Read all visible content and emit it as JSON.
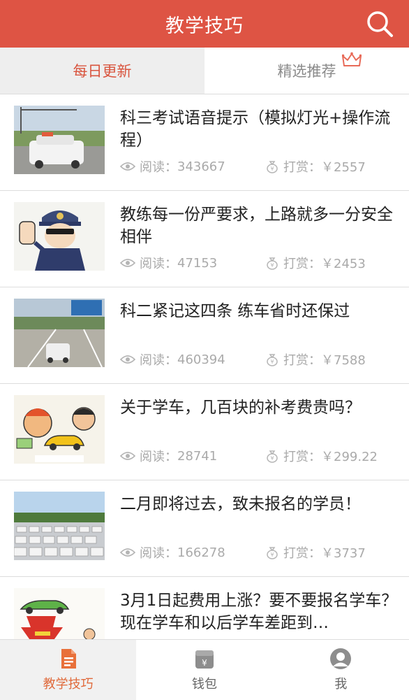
{
  "header": {
    "title": "教学技巧",
    "search_icon": "search-icon"
  },
  "tabs": [
    {
      "label": "每日更新",
      "active": true
    },
    {
      "label": "精选推荐",
      "active": false,
      "badge_icon": "crown-icon"
    }
  ],
  "articles": [
    {
      "title": "科三考试语音提示（模拟灯光+操作流程）",
      "read_label": "阅读：",
      "reads": "343667",
      "reward_label": "打赏：",
      "reward": "￥2557"
    },
    {
      "title": "教练每一份严要求，上路就多一分安全相伴",
      "read_label": "阅读：",
      "reads": "47153",
      "reward_label": "打赏：",
      "reward": "￥2453"
    },
    {
      "title": "科二紧记这四条 练车省时还保过",
      "read_label": "阅读：",
      "reads": "460394",
      "reward_label": "打赏：",
      "reward": "￥7588"
    },
    {
      "title": "关于学车，几百块的补考费贵吗？",
      "read_label": "阅读：",
      "reads": "28741",
      "reward_label": "打赏：",
      "reward": "￥299.22"
    },
    {
      "title": "二月即将过去，致未报名的学员！",
      "read_label": "阅读：",
      "reads": "166278",
      "reward_label": "打赏：",
      "reward": "￥3737"
    },
    {
      "title": "3月1日起费用上涨？要不要报名学车？现在学车和以后学车差距到…",
      "read_label": "",
      "reads": "",
      "reward_label": "",
      "reward": ""
    }
  ],
  "bottom_nav": [
    {
      "label": "教学技巧",
      "icon": "document-icon",
      "active": true
    },
    {
      "label": "钱包",
      "icon": "wallet-icon",
      "active": false
    },
    {
      "label": "我",
      "icon": "user-icon",
      "active": false
    }
  ],
  "colors": {
    "brand": "#de5444",
    "accent": "#e06a3c",
    "text": "#222222",
    "muted": "#aaaaaa"
  }
}
